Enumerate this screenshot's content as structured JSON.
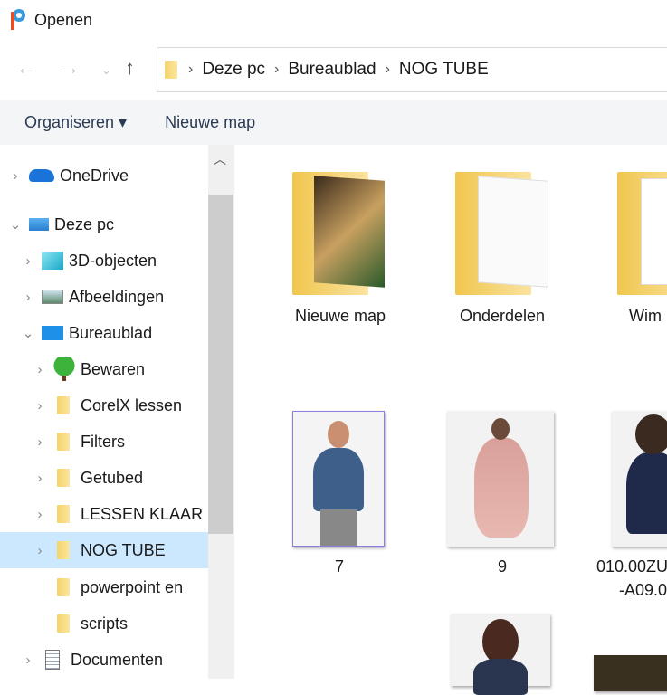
{
  "window": {
    "title": "Openen"
  },
  "nav": {
    "back_icon": "arrow-left",
    "forward_icon": "arrow-right",
    "recent_icon": "chevron-down",
    "up_icon": "arrow-up"
  },
  "address": {
    "crumbs": [
      "Deze pc",
      "Bureaublad",
      "NOG TUBE"
    ]
  },
  "toolbar": {
    "organize": "Organiseren ▾",
    "new_folder": "Nieuwe map"
  },
  "tree": [
    {
      "label": "OneDrive",
      "icon": "onedrive-cloud",
      "state": "collapsed"
    },
    {
      "label": "Deze pc",
      "icon": "computer",
      "state": "expanded"
    },
    {
      "label": "3D-objecten",
      "icon": "3d-cube",
      "state": "collapsed"
    },
    {
      "label": "Afbeeldingen",
      "icon": "pictures",
      "state": "collapsed"
    },
    {
      "label": "Bureaublad",
      "icon": "desktop",
      "state": "expanded"
    },
    {
      "label": "Bewaren",
      "icon": "tree",
      "state": "collapsed"
    },
    {
      "label": "CorelX lessen",
      "icon": "folder",
      "state": "collapsed"
    },
    {
      "label": "Filters",
      "icon": "folder",
      "state": "collapsed"
    },
    {
      "label": "Getubed",
      "icon": "folder",
      "state": "collapsed"
    },
    {
      "label": "LESSEN KLAAR",
      "icon": "folder",
      "state": "collapsed"
    },
    {
      "label": "NOG TUBE",
      "icon": "folder",
      "state": "collapsed",
      "selected": true
    },
    {
      "label": "powerpoint en",
      "icon": "folder",
      "state": "none"
    },
    {
      "label": "scripts",
      "icon": "folder",
      "state": "none"
    },
    {
      "label": "Documenten",
      "icon": "documents",
      "state": "collapsed"
    }
  ],
  "files": [
    {
      "name": "Nieuwe map",
      "type": "folder"
    },
    {
      "name": "Onderdelen",
      "type": "folder"
    },
    {
      "name": "Wim",
      "type": "folder"
    },
    {
      "name": "7",
      "type": "image"
    },
    {
      "name": "9",
      "type": "image"
    },
    {
      "name": "010.00ZU",
      "name2": "-A09.0",
      "type": "image"
    }
  ],
  "colors": {
    "selected": "#cce8ff",
    "toolbar": "#f3f5f7",
    "folder": "#f4d46a"
  }
}
